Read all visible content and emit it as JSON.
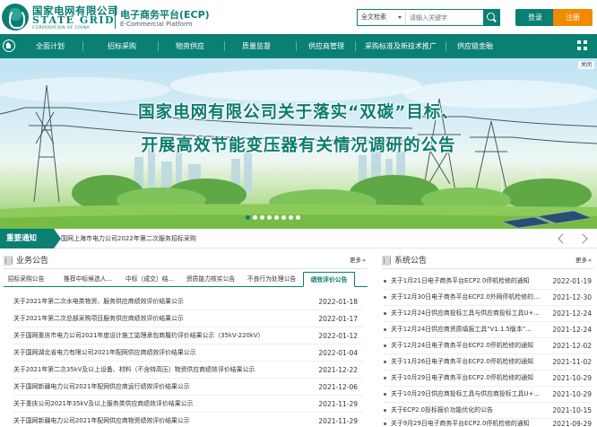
{
  "header": {
    "logo_cn": "国家电网有限公司",
    "logo_en": "STATE GRID",
    "logo_sub": "CORPORATION OF CHINA",
    "platform_title": "电子商务平台(ECP)",
    "platform_sub": "E-Commercial Platform",
    "search_scope": "全文检索",
    "search_placeholder": "请输入关键字",
    "login_label": "登录",
    "register_label": "注册"
  },
  "nav": {
    "items": [
      "全面计划",
      "招标采购",
      "物资供应",
      "质量监督",
      "供应商管理",
      "采购标准及新技术推广",
      "供应链金融"
    ]
  },
  "banner": {
    "close_label": "关闭",
    "headline_line1": "国家电网有限公司关于落实“双碳”目标、",
    "headline_line2": "开展高效节能变压器有关情况调研的公告",
    "slide_count": 8,
    "active_slide": 0
  },
  "notice": {
    "label": "重要通知",
    "text": "国网上海市电力公司2022年第二次服务招标采购"
  },
  "business": {
    "title": "业务公告",
    "more": "更多",
    "tabs": [
      "招标采购公告",
      "推荐中标候选人...",
      "中标（成交）结...",
      "资质能力核实公告",
      "不良行为处理公告",
      "绩效评价公告"
    ],
    "active_tab": 5,
    "rows": [
      {
        "title": "关于2021年第二次水电类物资、服务供应商绩效评价结果公示",
        "date": "2022-01-18"
      },
      {
        "title": "关于2021年第二次总部采购项目服务供应商绩效评价结果公示",
        "date": "2022-01-17"
      },
      {
        "title": "关于国网重庆市电力公司2021年度设计施工监理承包商履约评价结果公示（35kV-220kV）",
        "date": "2022-01-12"
      },
      {
        "title": "关于国网湖北省电力有限公司2021年配网供应商绩效评价结果公示",
        "date": "2022-01-04"
      },
      {
        "title": "关于2021年第二次35kV及以上设备、材料（不含特高压）物资供应商绩效评价结果公示",
        "date": "2021-12-22"
      },
      {
        "title": "关于国网新疆电力公司2021年配网供应商运行绩效评价结果公示",
        "date": "2021-12-06"
      },
      {
        "title": "关于重庆公司2021年35kV及以上服务类供应商绩效评价结果公示",
        "date": "2021-11-29"
      },
      {
        "title": "关于国网新疆电力公司2021年配网供应商物资绩效评价结果公示",
        "date": "2021-11-29"
      }
    ]
  },
  "system": {
    "title": "系统公告",
    "more": "更多",
    "rows": [
      {
        "title": "关于1月21日电子商务平台ECP2.0停机检修的通知",
        "date": "2022-01-19"
      },
      {
        "title": "关于12月30日电子商务平台ECP2.0外网停机检修的...",
        "date": "2021-12-30"
      },
      {
        "title": "关于12月24日供应商投标工具与供应商投标工具U+...",
        "date": "2021-12-24"
      },
      {
        "title": "关于12月24日供应商资质填报工具“V1.1.5版本”...",
        "date": "2021-12-24"
      },
      {
        "title": "关于12月24日电子商务平台ECP2.0停机检修的通知",
        "date": "2021-12-02"
      },
      {
        "title": "关于11月26日电子商务平台ECP2.0停机检修的通知",
        "date": "2021-11-02"
      },
      {
        "title": "关于10月29日电子商务平台ECP2.0停机检修的通知",
        "date": "2021-10-29"
      },
      {
        "title": "关于10月29日供应商投标工具与供应商投标工具U+...",
        "date": "2021-10-29"
      },
      {
        "title": "关于ECP2.0投标报价功能优化的公告",
        "date": "2021-10-15"
      },
      {
        "title": "关于9月29日电子商务平台ECP2.0停机检修的通知",
        "date": "2021-09-29"
      }
    ]
  },
  "colors": {
    "brand_green": "#0a7f73",
    "register_orange": "#f08a00"
  },
  "icons": [
    "search-icon",
    "home-icon",
    "grid-menu-icon",
    "chevron-left-icon",
    "chevron-right-icon",
    "section-icon"
  ]
}
